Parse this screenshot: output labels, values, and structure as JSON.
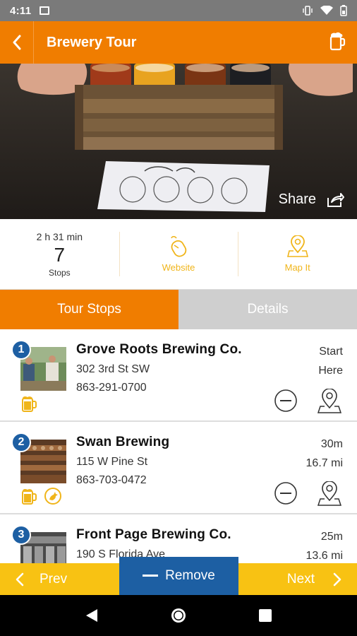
{
  "status": {
    "time": "4:11"
  },
  "appbar": {
    "title": "Brewery Tour"
  },
  "hero": {
    "share_label": "Share"
  },
  "stats": {
    "duration": "2 h 31 min",
    "stop_count": "7",
    "stops_label": "Stops",
    "website_label": "Website",
    "map_label": "Map It"
  },
  "tabs": {
    "stops": "Tour Stops",
    "details": "Details"
  },
  "stops": [
    {
      "number": "1",
      "name": "Grove Roots Brewing Co.",
      "address": "302 3rd St SW",
      "phone": "863-291-0700",
      "right_top": "Start",
      "right_bottom": "Here"
    },
    {
      "number": "2",
      "name": "Swan Brewing",
      "address": "115 W Pine St",
      "phone": "863-703-0472",
      "right_top": "30m",
      "right_bottom": "16.7 mi"
    },
    {
      "number": "3",
      "name": "Front Page Brewing Co.",
      "address": "190 S Florida Ave",
      "phone": "",
      "right_top": "25m",
      "right_bottom": "13.6 mi"
    }
  ],
  "bottom": {
    "prev": "Prev",
    "remove": "Remove",
    "next": "Next"
  },
  "colors": {
    "accent": "#f07d00",
    "blue": "#1d5fa3",
    "yellow": "#f8c213",
    "gold": "#f0b51a"
  }
}
